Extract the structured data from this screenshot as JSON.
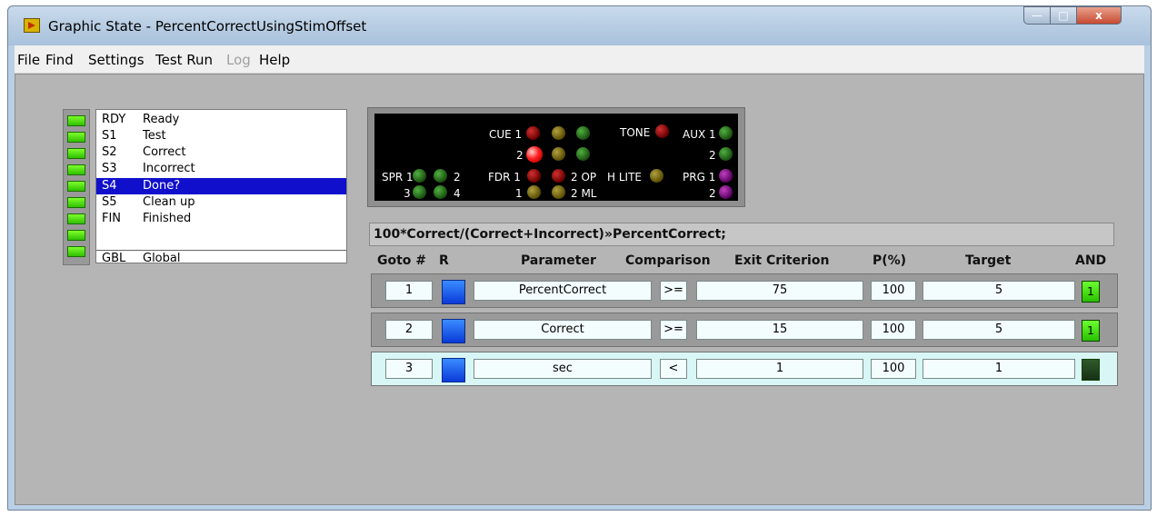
{
  "window": {
    "title": "Graphic State - PercentCorrectUsingStimOffset",
    "min_label": "—",
    "max_label": "□",
    "close_label": "x"
  },
  "menu": [
    "File",
    "Find",
    "Settings",
    "Test Run",
    "Log",
    "Help"
  ],
  "menu_disabled": [
    "Log"
  ],
  "states": [
    {
      "code": "RDY",
      "name": "Ready"
    },
    {
      "code": "S1",
      "name": "Test"
    },
    {
      "code": "S2",
      "name": "Correct"
    },
    {
      "code": "S3",
      "name": "Incorrect"
    },
    {
      "code": "S4",
      "name": "Done?"
    },
    {
      "code": "S5",
      "name": "Clean up"
    },
    {
      "code": "FIN",
      "name": "Finished"
    },
    {
      "code": "GBL",
      "name": "Global"
    }
  ],
  "selected_state": "S4",
  "indicators": {
    "cue1": "CUE 1",
    "cue2": "2",
    "tone": "TONE",
    "aux1": "AUX 1",
    "aux2": "2",
    "spr1": "SPR 1",
    "spr2": "2",
    "spr3": "3",
    "spr4": "4",
    "fdr1": "FDR 1",
    "fdr_1b": "1",
    "op": "2 OP",
    "ml": "2 ML",
    "hlite": "H LITE",
    "prg1": "PRG 1",
    "prg2": "2"
  },
  "formula": "100*Correct/(Correct+Incorrect)»PercentCorrect;",
  "table": {
    "headers": {
      "goto": "Goto #",
      "r": "R",
      "parameter": "Parameter",
      "comparison": "Comparison",
      "exit": "Exit Criterion",
      "p": "P(%)",
      "target": "Target",
      "and": "AND"
    },
    "rows": [
      {
        "goto": "1",
        "parameter": "PercentCorrect",
        "comparison": ">=",
        "exit": "75",
        "p": "100",
        "target": "5",
        "and": "1",
        "and_on": true
      },
      {
        "goto": "2",
        "parameter": "Correct",
        "comparison": ">=",
        "exit": "15",
        "p": "100",
        "target": "5",
        "and": "1",
        "and_on": true
      },
      {
        "goto": "3",
        "parameter": "sec",
        "comparison": "<",
        "exit": "1",
        "p": "100",
        "target": "1",
        "and": "",
        "and_on": false
      }
    ]
  },
  "colors": {
    "lamp_on": "#2fc000",
    "selection": "#1010cc",
    "r_button": "#0a3ad8",
    "active_row": "#d8f6f6"
  }
}
